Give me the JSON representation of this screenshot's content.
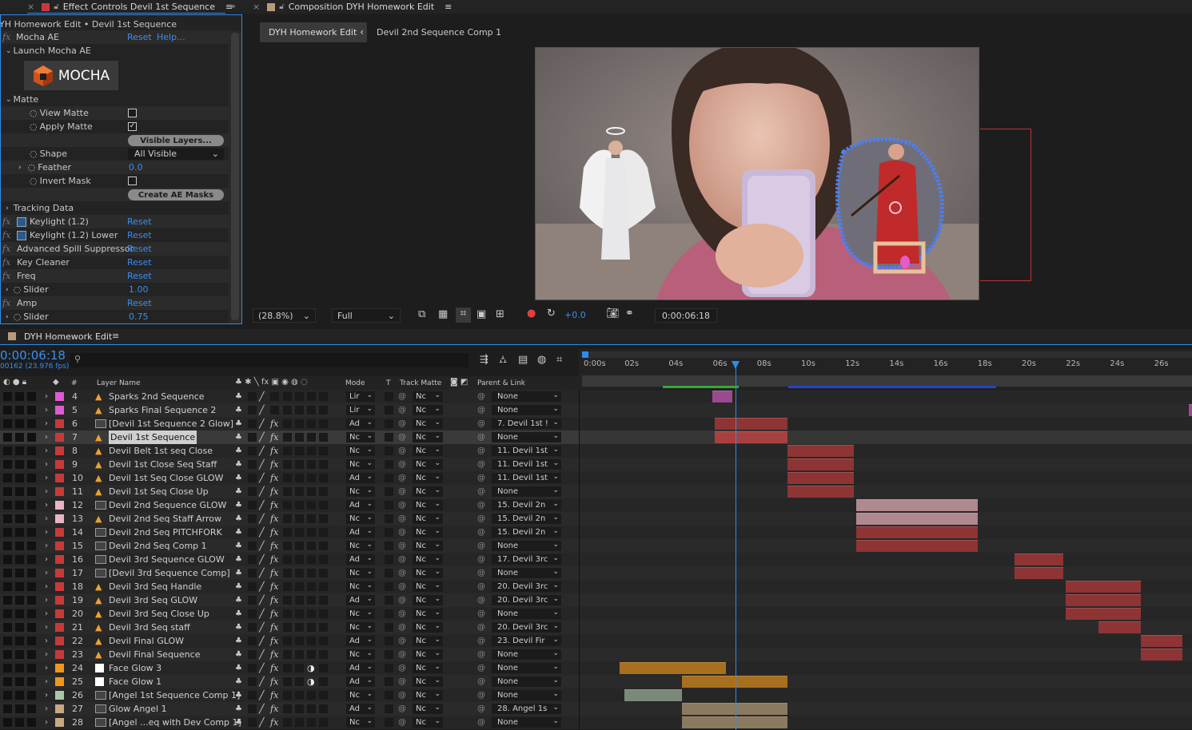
{
  "tabs": {
    "effect_controls": "Effect Controls Devil 1st Sequence",
    "composition": "Composition DYH Homework Edit"
  },
  "effect_controls": {
    "breadcrumb": "YH Homework Edit • Devil 1st Sequence",
    "mocha_name": "Mocha AE",
    "reset": "Reset",
    "help": "Help...",
    "launch_mocha": "Launch Mocha AE",
    "mocha_logo": "MOCHA",
    "matte_group": "Matte",
    "view_matte": "View Matte",
    "apply_matte": "Apply Matte",
    "visible_layers_btn": "Visible Layers...",
    "shape": "Shape",
    "shape_value": "All Visible",
    "feather": "Feather",
    "feather_value": "0.0",
    "invert_mask": "Invert Mask",
    "create_masks_btn": "Create AE Masks",
    "tracking_data": "Tracking Data",
    "effects": [
      {
        "name": "Keylight (1.2)",
        "reset": "Reset"
      },
      {
        "name": "Keylight (1.2) Lower",
        "reset": "Reset"
      },
      {
        "name": "Advanced Spill Suppressor",
        "reset": "Reset"
      },
      {
        "name": "Key Cleaner",
        "reset": "Reset"
      },
      {
        "name": "Freq",
        "reset": "Reset"
      },
      {
        "name": "Slider",
        "value": "1.00"
      },
      {
        "name": "Amp",
        "reset": "Reset"
      },
      {
        "name": "Slider",
        "value": "0.75"
      }
    ]
  },
  "viewer": {
    "comp_tab": "DYH Homework Edit",
    "comp_crumb": "Devil 2nd Sequence Comp 1",
    "zoom": "(28.8%)",
    "resolution": "Full",
    "exposure": "+0.0",
    "timecode": "0:00:06:18"
  },
  "timeline": {
    "title": "DYH Homework Edit",
    "timecode": "0:00:06:18",
    "frames": "00162 (23.976 fps)",
    "search_placeholder": "",
    "col_hash": "#",
    "col_layer": "Layer Name",
    "col_mode": "Mode",
    "col_t": "T",
    "col_trackmatte": "Track Matte",
    "col_parent": "Parent & Link",
    "ruler": [
      "0:00s",
      "02s",
      "04s",
      "06s",
      "08s",
      "10s",
      "12s",
      "14s",
      "16s",
      "18s",
      "20s",
      "22s",
      "24s",
      "26s"
    ],
    "playhead_seconds": 6.75,
    "layers": [
      {
        "num": "4",
        "color": "#e05bd3",
        "name": "Sparks 2nd Sequence",
        "icon": "shape",
        "mode": "Lir",
        "matte": "Nc",
        "parent": "None",
        "start": 5.7,
        "end": 6.6,
        "barcolor": "#9a4a8e",
        "fx": false
      },
      {
        "num": "5",
        "color": "#e05bd3",
        "name": "Sparks Final Sequence 2",
        "icon": "shape",
        "mode": "Lir",
        "matte": "Nc",
        "parent": "None",
        "start": 27.3,
        "end": 28,
        "barcolor": "#9a4a8e",
        "fx": false
      },
      {
        "num": "6",
        "color": "#c83a3a",
        "name": "[Devil 1st Sequence 2 Glow]",
        "icon": "comp",
        "mode": "Ad",
        "matte": "Nc",
        "parent": "7. Devil 1st !",
        "start": 5.8,
        "end": 9.1,
        "barcolor": "#8e3434",
        "fx": true
      },
      {
        "num": "7",
        "color": "#c83a3a",
        "name": "Devil 1st Sequence",
        "icon": "shape",
        "mode": "Nc",
        "matte": "Nc",
        "parent": "None",
        "start": 5.8,
        "end": 9.1,
        "barcolor": "#a84040",
        "fx": true,
        "selected": true
      },
      {
        "num": "8",
        "color": "#c83a3a",
        "name": "Devil Belt 1st seq Close",
        "icon": "shape",
        "mode": "Nc",
        "matte": "Nc",
        "parent": "11. Devil 1st",
        "start": 9.1,
        "end": 12.1,
        "barcolor": "#8e3434",
        "fx": true
      },
      {
        "num": "9",
        "color": "#c83a3a",
        "name": "Devil 1st Close Seq Staff",
        "icon": "shape",
        "mode": "Nc",
        "matte": "Nc",
        "parent": "11. Devil 1st",
        "start": 9.1,
        "end": 12.1,
        "barcolor": "#8e3434",
        "fx": true
      },
      {
        "num": "10",
        "color": "#c83a3a",
        "name": "Devil 1st Seq Close GLOW",
        "icon": "shape",
        "mode": "Ad",
        "matte": "Nc",
        "parent": "11. Devil 1st",
        "start": 9.1,
        "end": 12.1,
        "barcolor": "#8e3434",
        "fx": true
      },
      {
        "num": "11",
        "color": "#c83a3a",
        "name": "Devil 1st Seq Close Up",
        "icon": "shape",
        "mode": "Nc",
        "matte": "Nc",
        "parent": "None",
        "start": 9.1,
        "end": 12.1,
        "barcolor": "#8e3434",
        "fx": true
      },
      {
        "num": "12",
        "color": "#e8b4c8",
        "name": "Devil 2nd Sequence GLOW",
        "icon": "comp",
        "mode": "Ad",
        "matte": "Nc",
        "parent": "15. Devil 2n",
        "start": 12.2,
        "end": 17.7,
        "barcolor": "#b08890",
        "fx": true
      },
      {
        "num": "13",
        "color": "#e8b4c8",
        "name": "Devil 2nd Seq Staff Arrow",
        "icon": "shape",
        "mode": "Nc",
        "matte": "Nc",
        "parent": "15. Devil 2n",
        "start": 12.2,
        "end": 17.7,
        "barcolor": "#b08890",
        "fx": true
      },
      {
        "num": "14",
        "color": "#c83a3a",
        "name": "Devil 2nd Seq PITCHFORK",
        "icon": "comp",
        "mode": "Ad",
        "matte": "Nc",
        "parent": "15. Devil 2n",
        "start": 12.2,
        "end": 17.7,
        "barcolor": "#8e3434",
        "fx": true
      },
      {
        "num": "15",
        "color": "#c83a3a",
        "name": "Devil 2nd Seq Comp 1",
        "icon": "comp",
        "mode": "Nc",
        "matte": "Nc",
        "parent": "None",
        "start": 12.2,
        "end": 17.7,
        "barcolor": "#8e3434",
        "fx": true
      },
      {
        "num": "16",
        "color": "#c83a3a",
        "name": "Devil 3rd Sequence GLOW",
        "icon": "comp",
        "mode": "Ad",
        "matte": "Nc",
        "parent": "17. Devil 3rc",
        "start": 19.4,
        "end": 21.6,
        "barcolor": "#8e3434",
        "fx": true
      },
      {
        "num": "17",
        "color": "#c83a3a",
        "name": "[Devil 3rd Sequence Comp]",
        "icon": "comp",
        "mode": "Nc",
        "matte": "Nc",
        "parent": "None",
        "start": 19.4,
        "end": 21.6,
        "barcolor": "#8e3434",
        "fx": true
      },
      {
        "num": "18",
        "color": "#c83a3a",
        "name": "Devil 3rd Seq Handle",
        "icon": "shape",
        "mode": "Nc",
        "matte": "Nc",
        "parent": "20. Devil 3rc",
        "start": 21.7,
        "end": 25.1,
        "barcolor": "#8e3434",
        "fx": true
      },
      {
        "num": "19",
        "color": "#c83a3a",
        "name": "Devil 3rd Seq GLOW",
        "icon": "shape",
        "mode": "Ad",
        "matte": "Nc",
        "parent": "20. Devil 3rc",
        "start": 21.7,
        "end": 25.1,
        "barcolor": "#8e3434",
        "fx": true
      },
      {
        "num": "20",
        "color": "#c83a3a",
        "name": "Devil 3rd Seq Close Up",
        "icon": "shape",
        "mode": "Nc",
        "matte": "Nc",
        "parent": "None",
        "start": 21.7,
        "end": 25.1,
        "barcolor": "#8e3434",
        "fx": true
      },
      {
        "num": "21",
        "color": "#c83a3a",
        "name": "Devil 3rd Seq staff",
        "icon": "shape",
        "mode": "Nc",
        "matte": "Nc",
        "parent": "20. Devil 3rc",
        "start": 23.2,
        "end": 25.1,
        "barcolor": "#8e3434",
        "fx": true
      },
      {
        "num": "22",
        "color": "#c83a3a",
        "name": "Devil Final GLOW",
        "icon": "shape",
        "mode": "Ad",
        "matte": "Nc",
        "parent": "23. Devil Fir",
        "start": 25.1,
        "end": 27.0,
        "barcolor": "#8e3434",
        "fx": true
      },
      {
        "num": "23",
        "color": "#c83a3a",
        "name": "Devil Final Sequence",
        "icon": "shape",
        "mode": "Nc",
        "matte": "Nc",
        "parent": "None",
        "start": 25.1,
        "end": 27.0,
        "barcolor": "#8e3434",
        "fx": true
      },
      {
        "num": "24",
        "color": "#f0961e",
        "name": "Face Glow 3",
        "icon": "solid",
        "mode": "Ad",
        "matte": "Nc",
        "parent": "None",
        "start": 1.5,
        "end": 6.3,
        "barcolor": "#a8701e",
        "fx": true
      },
      {
        "num": "25",
        "color": "#f0961e",
        "name": "Face Glow 1",
        "icon": "solid",
        "mode": "Ad",
        "matte": "Nc",
        "parent": "None",
        "start": 4.3,
        "end": 9.1,
        "barcolor": "#a8701e",
        "fx": true
      },
      {
        "num": "26",
        "color": "#a8c8a8",
        "name": "[Angel 1st Sequence Comp 1]",
        "icon": "comp",
        "mode": "Nc",
        "matte": "Nc",
        "parent": "None",
        "start": 1.7,
        "end": 4.3,
        "barcolor": "#7a8a7a",
        "fx": true
      },
      {
        "num": "27",
        "color": "#c8a880",
        "name": "Glow Angel 1",
        "icon": "comp",
        "mode": "Ad",
        "matte": "Nc",
        "parent": "28. Angel 1s",
        "start": 4.3,
        "end": 9.1,
        "barcolor": "#8a7a60",
        "fx": true
      },
      {
        "num": "28",
        "color": "#c8a880",
        "name": "[Angel ...eq with Dev Comp 1]",
        "icon": "comp",
        "mode": "Nc",
        "matte": "Nc",
        "parent": "None",
        "start": 4.3,
        "end": 9.1,
        "barcolor": "#8a7a60",
        "fx": true
      }
    ]
  },
  "colors": {
    "accent": "#2d8ceb",
    "link": "#3b8ef0",
    "playhead": "#2d8ceb"
  }
}
